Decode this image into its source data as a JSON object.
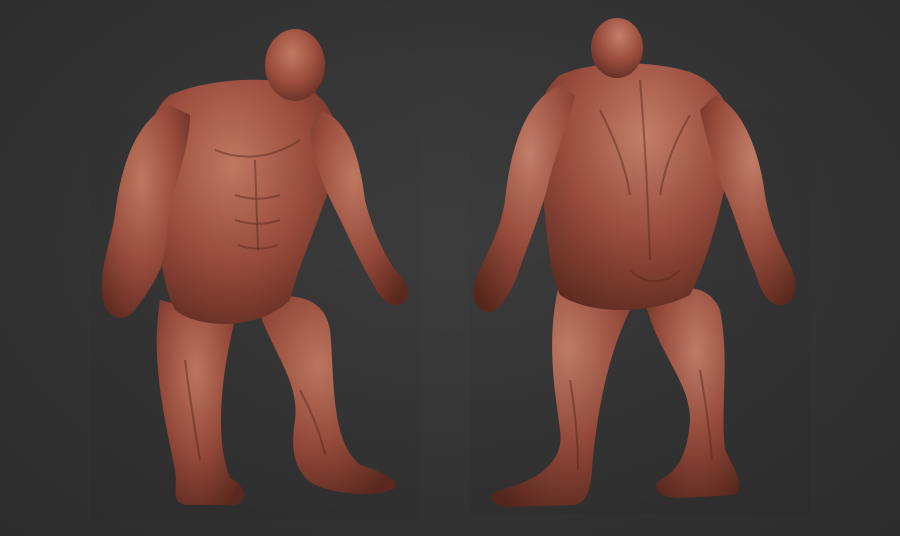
{
  "scene": {
    "background_color": "#333333",
    "clay_color": "#9a4c3c",
    "clay_highlight": "#c27a62",
    "clay_shadow": "#5e2a20",
    "views": [
      {
        "label": "",
        "pose": "front"
      },
      {
        "label": "",
        "pose": "back"
      }
    ]
  }
}
